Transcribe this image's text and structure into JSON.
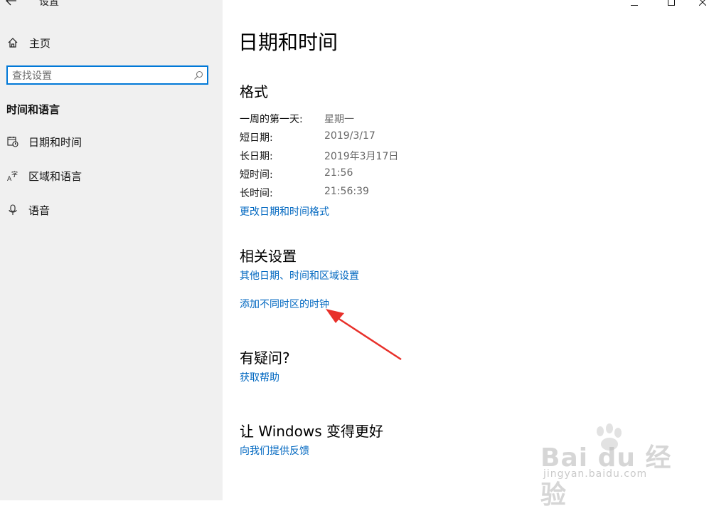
{
  "window": {
    "title": "设置",
    "back_icon": "back-arrow-icon"
  },
  "sidebar": {
    "home_label": "主页",
    "search_placeholder": "查找设置",
    "section_title": "时间和语言",
    "items": [
      {
        "label": "日期和时间",
        "icon": "calendar-clock-icon"
      },
      {
        "label": "区域和语言",
        "icon": "language-icon"
      },
      {
        "label": "语音",
        "icon": "microphone-icon"
      }
    ]
  },
  "main": {
    "title": "日期和时间",
    "format": {
      "heading": "格式",
      "rows": [
        {
          "label": "一周的第一天:",
          "value": "星期一"
        },
        {
          "label": "短日期:",
          "value": "2019/3/17"
        },
        {
          "label": "长日期:",
          "value": "2019年3月17日"
        },
        {
          "label": "短时间:",
          "value": "21:56"
        },
        {
          "label": "长时间:",
          "value": "21:56:39"
        }
      ],
      "change_link": "更改日期和时间格式"
    },
    "related": {
      "heading": "相关设置",
      "links": [
        "其他日期、时间和区域设置",
        "添加不同时区的时钟"
      ]
    },
    "help": {
      "heading": "有疑问?",
      "link": "获取帮助"
    },
    "feedback": {
      "heading": "让 Windows 变得更好",
      "link": "向我们提供反馈"
    }
  },
  "watermark": {
    "text": "Bai du 经验",
    "sub": "jingyan.baidu.com"
  },
  "colors": {
    "accent": "#0078d7",
    "link": "#0067c0",
    "sidebar_bg": "#f0f0f0",
    "arrow": "#e8302a"
  }
}
